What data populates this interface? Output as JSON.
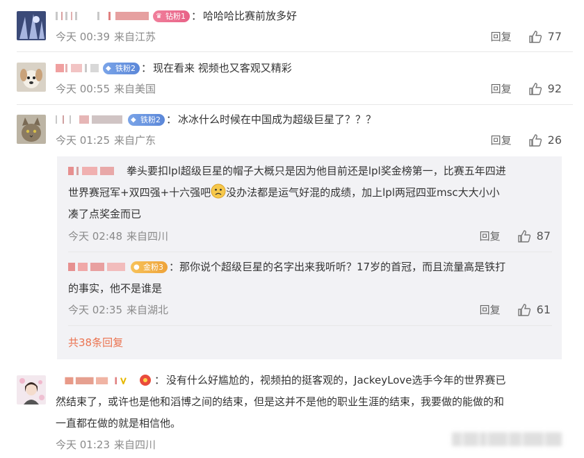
{
  "colors": {
    "accent": "#eb7350",
    "meta": "#8a8a8a",
    "reply_bg": "#f2f2f5"
  },
  "comments": [
    {
      "badge": "钻粉1",
      "badge_type": "diamond",
      "text": "哈哈哈比赛前放多好",
      "time": "今天 00:39",
      "location": "来自江苏",
      "reply": "回复",
      "likes": "77"
    },
    {
      "badge": "铁粉2",
      "badge_type": "iron",
      "text": "现在看来 视频也又客观又精彩",
      "time": "今天 00:55",
      "location": "来自美国",
      "reply": "回复",
      "likes": "92"
    },
    {
      "badge": "铁粉2",
      "badge_type": "iron",
      "text": "冰冰什么时候在中国成为超级巨星了？？？",
      "time": "今天 01:25",
      "location": "来自广东",
      "reply": "回复",
      "likes": "26"
    }
  ],
  "replies": [
    {
      "text_line1": "拳头要扣lpl超级巨星的帽子大概只是因为他目前还是lpl奖金榜第一，比赛五年四进",
      "text_line2a": "世界赛冠军+双四强+十六强吧",
      "text_line2b": "没办法都是运气好混的成绩，加上lpl两冠四亚msc大大小小",
      "text_line3": "凑了点奖金而已",
      "time": "今天 02:48",
      "location": "来自四川",
      "reply": "回复",
      "likes": "87"
    },
    {
      "badge": "金粉3",
      "badge_type": "gold",
      "text_line1": "那你说个超级巨星的名字出来我听听？17岁的首冠，而且流量高是铁打",
      "text_line2": "的事实，他不是谁是",
      "time": "今天 02:35",
      "location": "来自湖北",
      "reply": "回复",
      "likes": "61"
    }
  ],
  "total_replies": "共38条回复",
  "last_comment": {
    "text_line1": "没有什么好尴尬的，视频拍的挺客观的，JackeyLove选手今年的世界赛已",
    "text_line2": "然结束了，或许也是他和滔博之间的结束，但是这并不是他的职业生涯的结束，我要做的能做的和",
    "text_line3": "一直都在做的就是相信他。",
    "time": "今天 01:23",
    "location": "来自四川"
  },
  "colon": "："
}
